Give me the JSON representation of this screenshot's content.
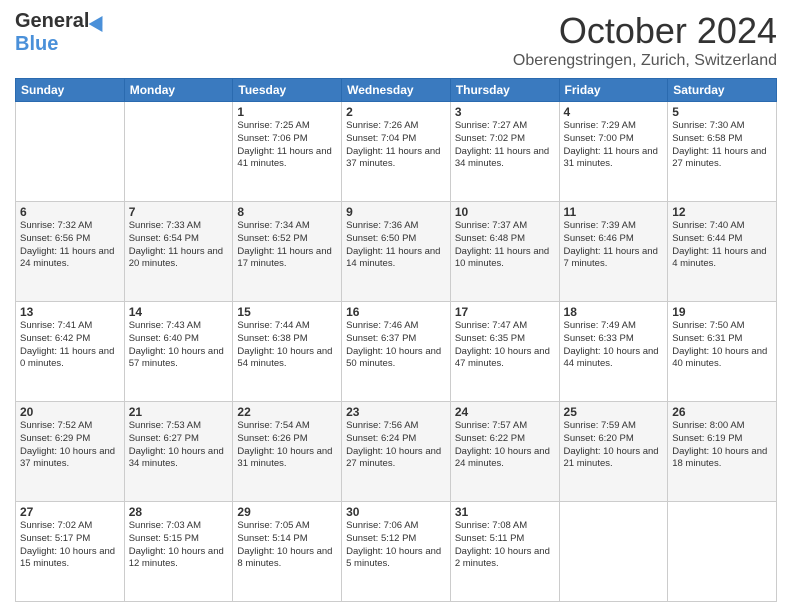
{
  "header": {
    "logo_line1": "General",
    "logo_line2": "Blue",
    "month": "October 2024",
    "location": "Oberengstringen, Zurich, Switzerland"
  },
  "days_of_week": [
    "Sunday",
    "Monday",
    "Tuesday",
    "Wednesday",
    "Thursday",
    "Friday",
    "Saturday"
  ],
  "weeks": [
    [
      {
        "day": "",
        "info": ""
      },
      {
        "day": "",
        "info": ""
      },
      {
        "day": "1",
        "info": "Sunrise: 7:25 AM\nSunset: 7:06 PM\nDaylight: 11 hours and 41 minutes."
      },
      {
        "day": "2",
        "info": "Sunrise: 7:26 AM\nSunset: 7:04 PM\nDaylight: 11 hours and 37 minutes."
      },
      {
        "day": "3",
        "info": "Sunrise: 7:27 AM\nSunset: 7:02 PM\nDaylight: 11 hours and 34 minutes."
      },
      {
        "day": "4",
        "info": "Sunrise: 7:29 AM\nSunset: 7:00 PM\nDaylight: 11 hours and 31 minutes."
      },
      {
        "day": "5",
        "info": "Sunrise: 7:30 AM\nSunset: 6:58 PM\nDaylight: 11 hours and 27 minutes."
      }
    ],
    [
      {
        "day": "6",
        "info": "Sunrise: 7:32 AM\nSunset: 6:56 PM\nDaylight: 11 hours and 24 minutes."
      },
      {
        "day": "7",
        "info": "Sunrise: 7:33 AM\nSunset: 6:54 PM\nDaylight: 11 hours and 20 minutes."
      },
      {
        "day": "8",
        "info": "Sunrise: 7:34 AM\nSunset: 6:52 PM\nDaylight: 11 hours and 17 minutes."
      },
      {
        "day": "9",
        "info": "Sunrise: 7:36 AM\nSunset: 6:50 PM\nDaylight: 11 hours and 14 minutes."
      },
      {
        "day": "10",
        "info": "Sunrise: 7:37 AM\nSunset: 6:48 PM\nDaylight: 11 hours and 10 minutes."
      },
      {
        "day": "11",
        "info": "Sunrise: 7:39 AM\nSunset: 6:46 PM\nDaylight: 11 hours and 7 minutes."
      },
      {
        "day": "12",
        "info": "Sunrise: 7:40 AM\nSunset: 6:44 PM\nDaylight: 11 hours and 4 minutes."
      }
    ],
    [
      {
        "day": "13",
        "info": "Sunrise: 7:41 AM\nSunset: 6:42 PM\nDaylight: 11 hours and 0 minutes."
      },
      {
        "day": "14",
        "info": "Sunrise: 7:43 AM\nSunset: 6:40 PM\nDaylight: 10 hours and 57 minutes."
      },
      {
        "day": "15",
        "info": "Sunrise: 7:44 AM\nSunset: 6:38 PM\nDaylight: 10 hours and 54 minutes."
      },
      {
        "day": "16",
        "info": "Sunrise: 7:46 AM\nSunset: 6:37 PM\nDaylight: 10 hours and 50 minutes."
      },
      {
        "day": "17",
        "info": "Sunrise: 7:47 AM\nSunset: 6:35 PM\nDaylight: 10 hours and 47 minutes."
      },
      {
        "day": "18",
        "info": "Sunrise: 7:49 AM\nSunset: 6:33 PM\nDaylight: 10 hours and 44 minutes."
      },
      {
        "day": "19",
        "info": "Sunrise: 7:50 AM\nSunset: 6:31 PM\nDaylight: 10 hours and 40 minutes."
      }
    ],
    [
      {
        "day": "20",
        "info": "Sunrise: 7:52 AM\nSunset: 6:29 PM\nDaylight: 10 hours and 37 minutes."
      },
      {
        "day": "21",
        "info": "Sunrise: 7:53 AM\nSunset: 6:27 PM\nDaylight: 10 hours and 34 minutes."
      },
      {
        "day": "22",
        "info": "Sunrise: 7:54 AM\nSunset: 6:26 PM\nDaylight: 10 hours and 31 minutes."
      },
      {
        "day": "23",
        "info": "Sunrise: 7:56 AM\nSunset: 6:24 PM\nDaylight: 10 hours and 27 minutes."
      },
      {
        "day": "24",
        "info": "Sunrise: 7:57 AM\nSunset: 6:22 PM\nDaylight: 10 hours and 24 minutes."
      },
      {
        "day": "25",
        "info": "Sunrise: 7:59 AM\nSunset: 6:20 PM\nDaylight: 10 hours and 21 minutes."
      },
      {
        "day": "26",
        "info": "Sunrise: 8:00 AM\nSunset: 6:19 PM\nDaylight: 10 hours and 18 minutes."
      }
    ],
    [
      {
        "day": "27",
        "info": "Sunrise: 7:02 AM\nSunset: 5:17 PM\nDaylight: 10 hours and 15 minutes."
      },
      {
        "day": "28",
        "info": "Sunrise: 7:03 AM\nSunset: 5:15 PM\nDaylight: 10 hours and 12 minutes."
      },
      {
        "day": "29",
        "info": "Sunrise: 7:05 AM\nSunset: 5:14 PM\nDaylight: 10 hours and 8 minutes."
      },
      {
        "day": "30",
        "info": "Sunrise: 7:06 AM\nSunset: 5:12 PM\nDaylight: 10 hours and 5 minutes."
      },
      {
        "day": "31",
        "info": "Sunrise: 7:08 AM\nSunset: 5:11 PM\nDaylight: 10 hours and 2 minutes."
      },
      {
        "day": "",
        "info": ""
      },
      {
        "day": "",
        "info": ""
      }
    ]
  ]
}
